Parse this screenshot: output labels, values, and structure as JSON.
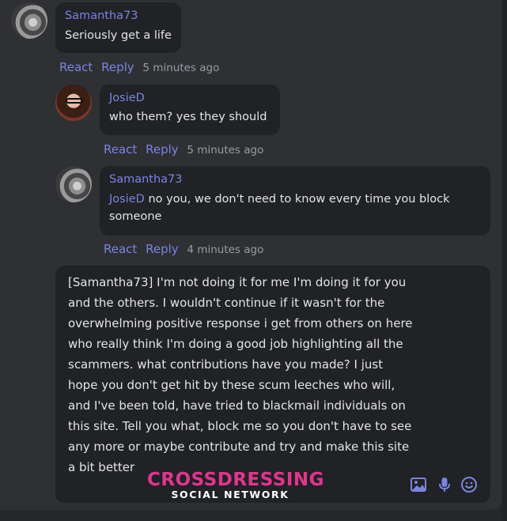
{
  "comments": [
    {
      "author": "Samantha73",
      "text": "Seriously get a life",
      "react": "React",
      "reply": "Reply",
      "time": "5 minutes ago"
    },
    {
      "author": "JosieD",
      "text": "who them? yes they should",
      "react": "React",
      "reply": "Reply",
      "time": "5 minutes ago"
    },
    {
      "author": "Samantha73",
      "mention": "JosieD",
      "text": "no you, we don't need to know every time you block someone",
      "react": "React",
      "reply": "Reply",
      "time": "4 minutes ago"
    }
  ],
  "composer": {
    "text": "[Samantha73] I'm not doing it for me I'm doing it for you and the others. I wouldn't continue if it wasn't for the overwhelming positive response i get from others on here who really think I'm doing a good job highlighting all the scammers. what contributions have you made? I just hope you don't get hit by these scum leeches who will, and I've been told, have tried to blackmail individuals on this site. Tell you what, block me so you don't have to see any more or maybe contribute and try and make this site a bit better",
    "icons": [
      "image-icon",
      "microphone-icon",
      "emoji-icon"
    ]
  },
  "watermark": {
    "title": "CROSSDRESSING",
    "subtitle": "SOCIAL NETWORK"
  },
  "colors": {
    "accent": "#7b84e0",
    "background": "#2e3034",
    "bubble": "#202226",
    "watermark": "#d83a8c"
  }
}
